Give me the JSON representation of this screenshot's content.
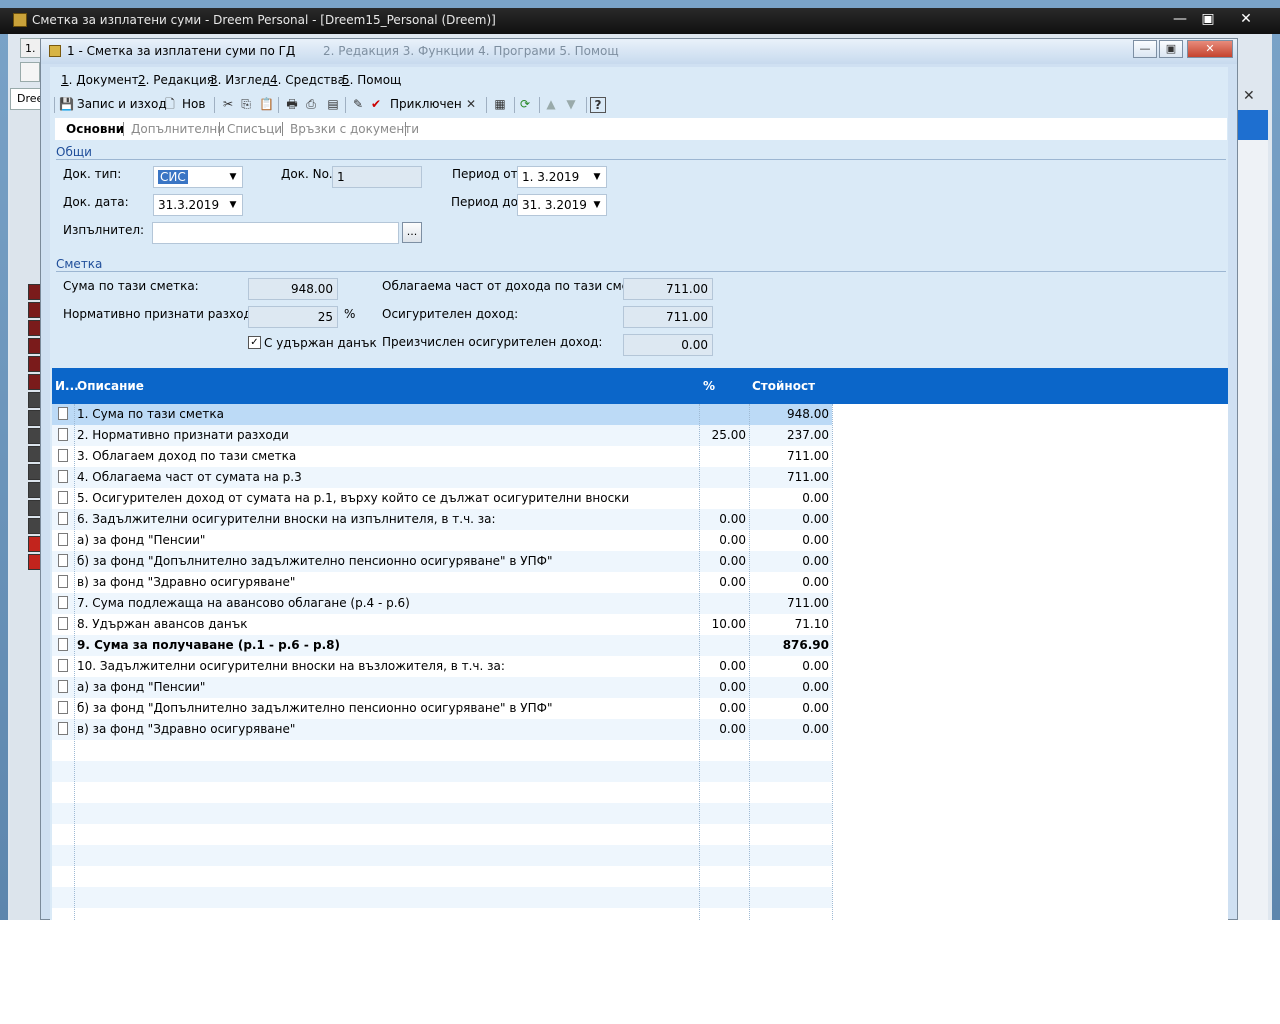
{
  "app": {
    "title": "Сметка за изплатени суми - Dreem Personal - [Dreem15_Personal (Dreem)]",
    "menu_ghost": "1.",
    "dree_label": "Dree",
    "controls": {
      "minimize": "—",
      "maximize": "▣",
      "close": "✕"
    }
  },
  "window": {
    "title": "1 - Сметка за изплатени суми по ГД",
    "behind_menu_ghost": "2. Редакция   3. Функции   4. Програми   5. Помощ"
  },
  "menu": [
    {
      "num": "1",
      "label": ". Документ"
    },
    {
      "num": "2",
      "label": ". Редакция"
    },
    {
      "num": "3",
      "label": ". Изглед"
    },
    {
      "num": "4",
      "label": ". Средства"
    },
    {
      "num": "5",
      "label": ". Помощ"
    }
  ],
  "toolbar": {
    "save_exit": "Запис и изход",
    "new": "Нов",
    "finished": "Приключен"
  },
  "tabs": [
    "Основни",
    "Допълнителни",
    "Списъци",
    "Връзки с документи"
  ],
  "general": {
    "section": "Общи",
    "doc_type_label": "Док. тип:",
    "doc_type_value": "СИС",
    "doc_no_label": "Док. No.",
    "doc_no_value": "1",
    "period_from_label": "Период от:",
    "period_from_value": "1.  3.2019",
    "doc_date_label": "Док. дата:",
    "doc_date_value": "31.3.2019",
    "period_to_label": "Период до:",
    "period_to_value": "31.  3.2019",
    "executor_label": "Изпълнител:",
    "executor_value": "",
    "dots": "..."
  },
  "account": {
    "section": "Сметка",
    "sum_label": "Сума по тази сметка:",
    "sum_value": "948.00",
    "norm_label": "Нормативно признати разходи:",
    "norm_value": "25",
    "norm_unit": "%",
    "withheld_label": "С удържан данък",
    "taxable_label": "Облагаема част от дохода по тази сметка:",
    "taxable_value": "711.00",
    "insured_label": "Осигурителен доход:",
    "insured_value": "711.00",
    "recalc_label": "Преизчислен осигурителен доход:",
    "recalc_value": "0.00"
  },
  "grid": {
    "columns": [
      "И...",
      "Описание",
      "%",
      "Стойност"
    ],
    "rows": [
      {
        "desc": "1. Сума по тази сметка",
        "pct": "",
        "value": "948.00",
        "bold": false
      },
      {
        "desc": "2. Нормативно признати разходи",
        "pct": "25.00",
        "value": "237.00",
        "bold": false
      },
      {
        "desc": "3. Облагаем доход по тази сметка",
        "pct": "",
        "value": "711.00",
        "bold": false
      },
      {
        "desc": "4. Облагаема част от сумата на р.3",
        "pct": "",
        "value": "711.00",
        "bold": false
      },
      {
        "desc": "5. Осигурителен доход от сумата на р.1, върху който се дължат осигурителни вноски",
        "pct": "",
        "value": "0.00",
        "bold": false
      },
      {
        "desc": "6. Задължителни осигурителни вноски на изпълнителя, в т.ч. за:",
        "pct": "0.00",
        "value": "0.00",
        "bold": false
      },
      {
        "desc": " а) за фонд \"Пенсии\"",
        "pct": "0.00",
        "value": "0.00",
        "bold": false
      },
      {
        "desc": " б) за фонд \"Допълнително задължително пенсионно осигуряване\" в УПФ\"",
        "pct": "0.00",
        "value": "0.00",
        "bold": false
      },
      {
        "desc": " в) за фонд \"Здравно осигуряване\"",
        "pct": "0.00",
        "value": "0.00",
        "bold": false
      },
      {
        "desc": "7. Сума подлежаща на авансово облагане (р.4 - р.6)",
        "pct": "",
        "value": "711.00",
        "bold": false
      },
      {
        "desc": "8. Удържан авансов данък",
        "pct": "10.00",
        "value": "71.10",
        "bold": false
      },
      {
        "desc": "9. Сума за получаване (р.1 - р.6 - р.8)",
        "pct": "",
        "value": "876.90",
        "bold": true
      },
      {
        "desc": "10. Задължителни осигурителни вноски на възложителя, в т.ч. за:",
        "pct": "0.00",
        "value": "0.00",
        "bold": false
      },
      {
        "desc": " а) за фонд \"Пенсии\"",
        "pct": "0.00",
        "value": "0.00",
        "bold": false
      },
      {
        "desc": " б) за фонд \"Допълнително задължително пенсионно осигуряване\" в УПФ\"",
        "pct": "0.00",
        "value": "0.00",
        "bold": false
      },
      {
        "desc": " в) за фонд \"Здравно осигуряване\"",
        "pct": "0.00",
        "value": "0.00",
        "bold": false
      }
    ]
  },
  "colors": {
    "grid_header": "#0b66c9",
    "selected_row": "#bcdaf6",
    "client_bg": "#daeaf7",
    "section_text": "#1f4e9a"
  }
}
